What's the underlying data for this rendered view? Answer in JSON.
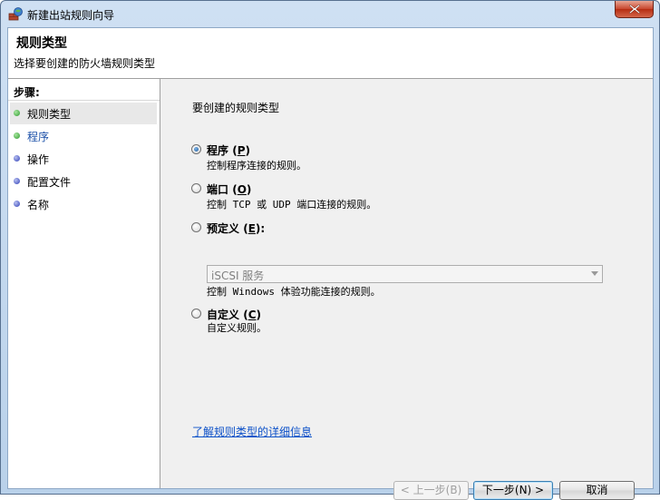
{
  "window": {
    "title": "新建出站规则向导",
    "icon": "firewall-wizard-icon"
  },
  "header": {
    "title": "规则类型",
    "subtitle": "选择要创建的防火墙规则类型"
  },
  "sidebar": {
    "title": "步骤:",
    "steps": [
      {
        "label": "规则类型",
        "state": "completed",
        "color": "#3caf3c"
      },
      {
        "label": "程序",
        "state": "current-link",
        "color": "#3caf3c"
      },
      {
        "label": "操作",
        "state": "pending",
        "color": "#4a5ad0"
      },
      {
        "label": "配置文件",
        "state": "pending",
        "color": "#4a5ad0"
      },
      {
        "label": "名称",
        "state": "pending",
        "color": "#4a5ad0"
      }
    ]
  },
  "main": {
    "question": "要创建的规则类型",
    "options": [
      {
        "label": "程序",
        "mnemonic": "P",
        "description": "控制程序连接的规则。",
        "checked": true
      },
      {
        "label": "端口",
        "mnemonic": "O",
        "description": "控制 TCP 或 UDP 端口连接的规则。",
        "checked": false
      },
      {
        "label": "预定义",
        "mnemonic": "E",
        "suffix": ":",
        "description": "控制 Windows 体验功能连接的规则。",
        "checked": false
      },
      {
        "label": "自定义",
        "mnemonic": "C",
        "description": "自定义规则。",
        "checked": false
      }
    ],
    "predefined_select": {
      "value": "iSCSI 服务",
      "enabled": false
    },
    "help_link": "了解规则类型的详细信息"
  },
  "buttons": {
    "back": "< 上一步(B)",
    "next": "下一步(N) >",
    "cancel": "取消"
  }
}
